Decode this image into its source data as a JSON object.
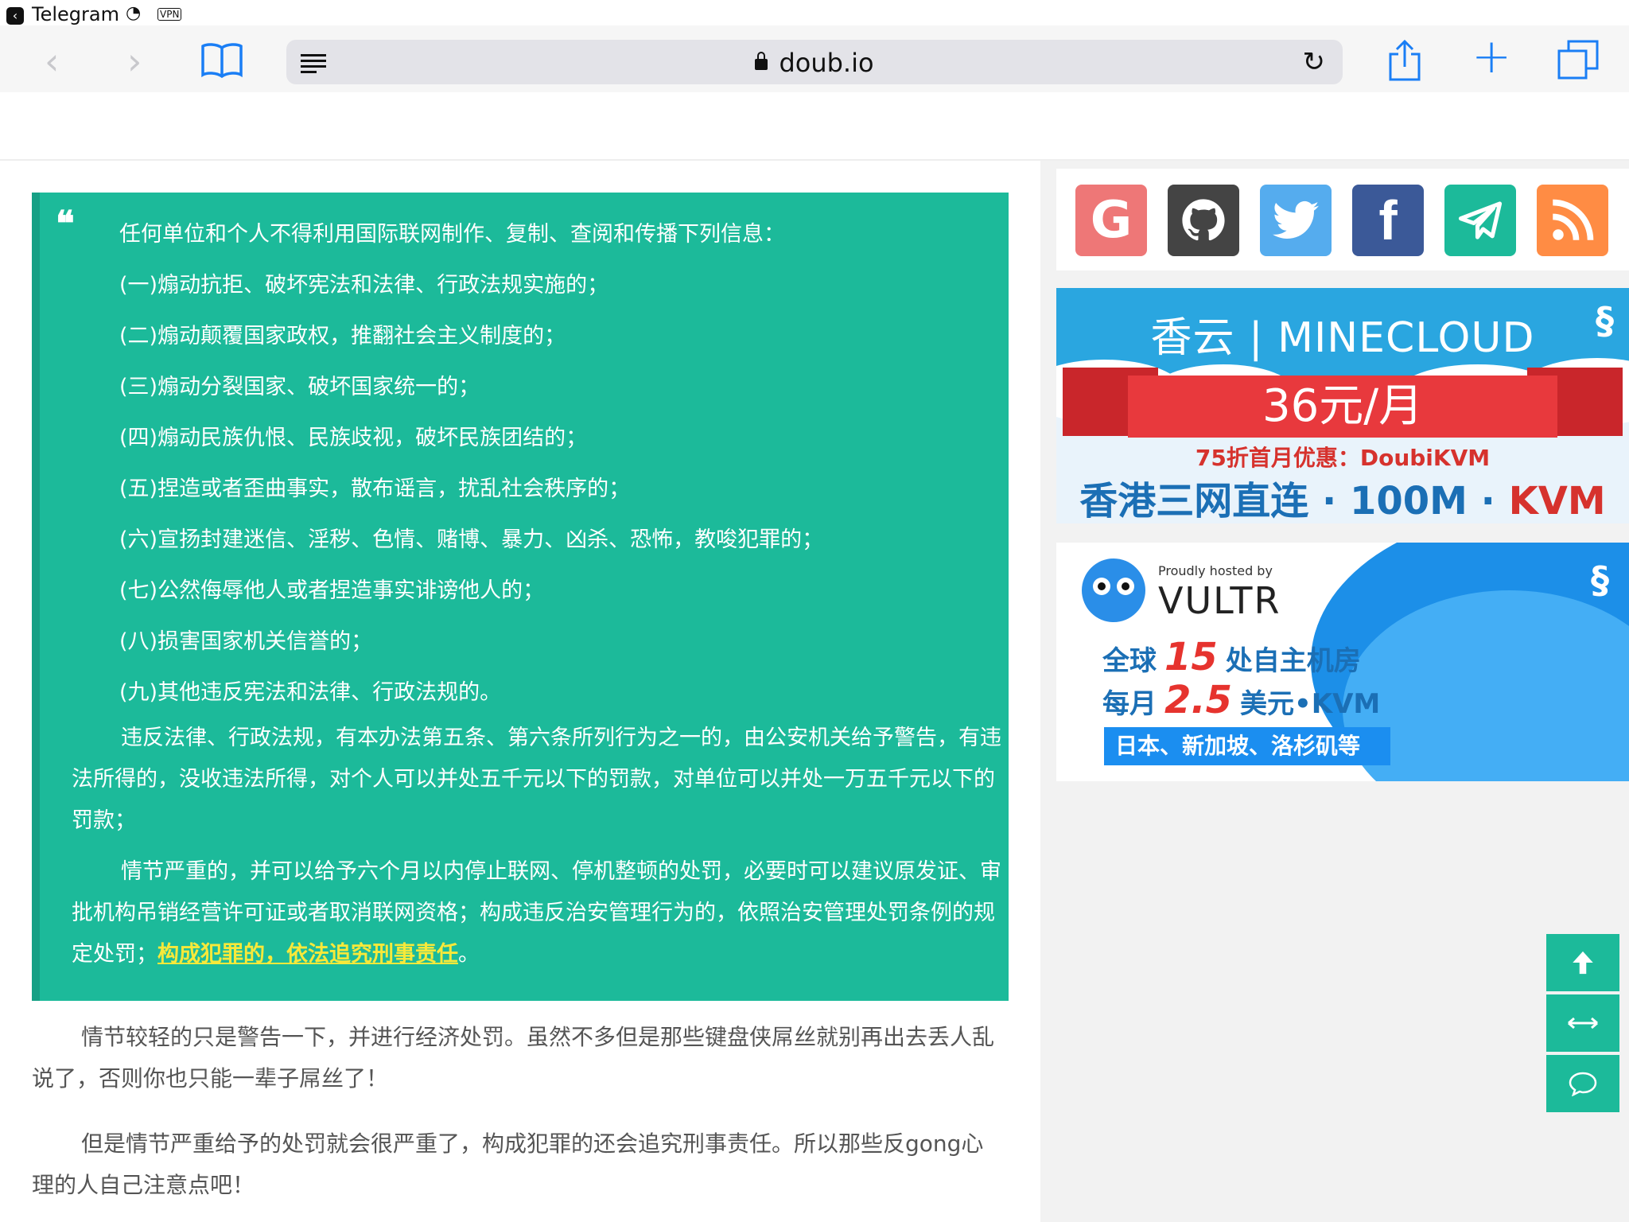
{
  "status_bar": {
    "back_app": "Telegram",
    "vpn": "VPN"
  },
  "browser": {
    "url": "doub.io"
  },
  "quote": {
    "mark": "❝",
    "lines": [
      "任何单位和个人不得利用国际联网制作、复制、查阅和传播下列信息：",
      "(一)煽动抗拒、破坏宪法和法律、行政法规实施的；",
      "(二)煽动颠覆国家政权，推翻社会主义制度的；",
      "(三)煽动分裂国家、破坏国家统一的；",
      "(四)煽动民族仇恨、民族歧视，破坏民族团结的；",
      "(五)捏造或者歪曲事实，散布谣言，扰乱社会秩序的；",
      "(六)宣扬封建迷信、淫秽、色情、赌博、暴力、凶杀、恐怖，教唆犯罪的；",
      "(七)公然侮辱他人或者捏造事实诽谤他人的；",
      "(八)损害国家机关信誉的；",
      "(九)其他违反宪法和法律、行政法规的。"
    ],
    "para1": "违反法律、行政法规，有本办法第五条、第六条所列行为之一的，由公安机关给予警告，有违法所得的，没收违法所得，对个人可以并处五千元以下的罚款，对单位可以并处一万五千元以下的罚款；",
    "para2_prefix": "情节严重的，并可以给予六个月以内停止联网、停机整顿的处罚，必要时可以建议原发证、审批机构吊销经营许可证或者取消联网资格；构成违反治安管理行为的，依照治安管理处罚条例的规定处罚；",
    "para2_highlight": "构成犯罪的，依法追究刑事责任",
    "para2_suffix": "。"
  },
  "body": {
    "p1": "情节较轻的只是警告一下，并进行经济处罚。虽然不多但是那些键盘侠屌丝就别再出去丢人乱说了，否则你也只能一辈子屌丝了！",
    "p2": "但是情节严重给予的处罚就会很严重了，构成犯罪的还会追究刑事责任。所以那些反gong心理的人自己注意点吧！"
  },
  "social": {
    "colors": {
      "google": "#ee7777",
      "github": "#444444",
      "twitter": "#55acee",
      "facebook": "#3b5998",
      "telegram": "#1cba9a",
      "rss": "#ff8c44"
    }
  },
  "ad_minecloud": {
    "brand": "香云 | MINECLOUD",
    "price": "36元/月",
    "promo": "75折首月优惠：DoubiKVM",
    "tagline_a": "香港三网直连 · 100M · ",
    "tagline_b": "KVM"
  },
  "ad_vultr": {
    "proudly": "Proudly hosted by",
    "brand": "VULTR",
    "l1_a": "全球",
    "l1_num": "15",
    "l1_b": "处自主机房",
    "l2_a": "每月",
    "l2_num": "2.5",
    "l2_b": "美元•KVM",
    "locations": "日本、新加坡、洛杉矶等"
  },
  "float_buttons": {
    "top_icon": "arrow-up-icon",
    "width_icon": "arrows-horizontal-icon",
    "comment_icon": "comment-icon"
  },
  "accent": "#1cba9a"
}
